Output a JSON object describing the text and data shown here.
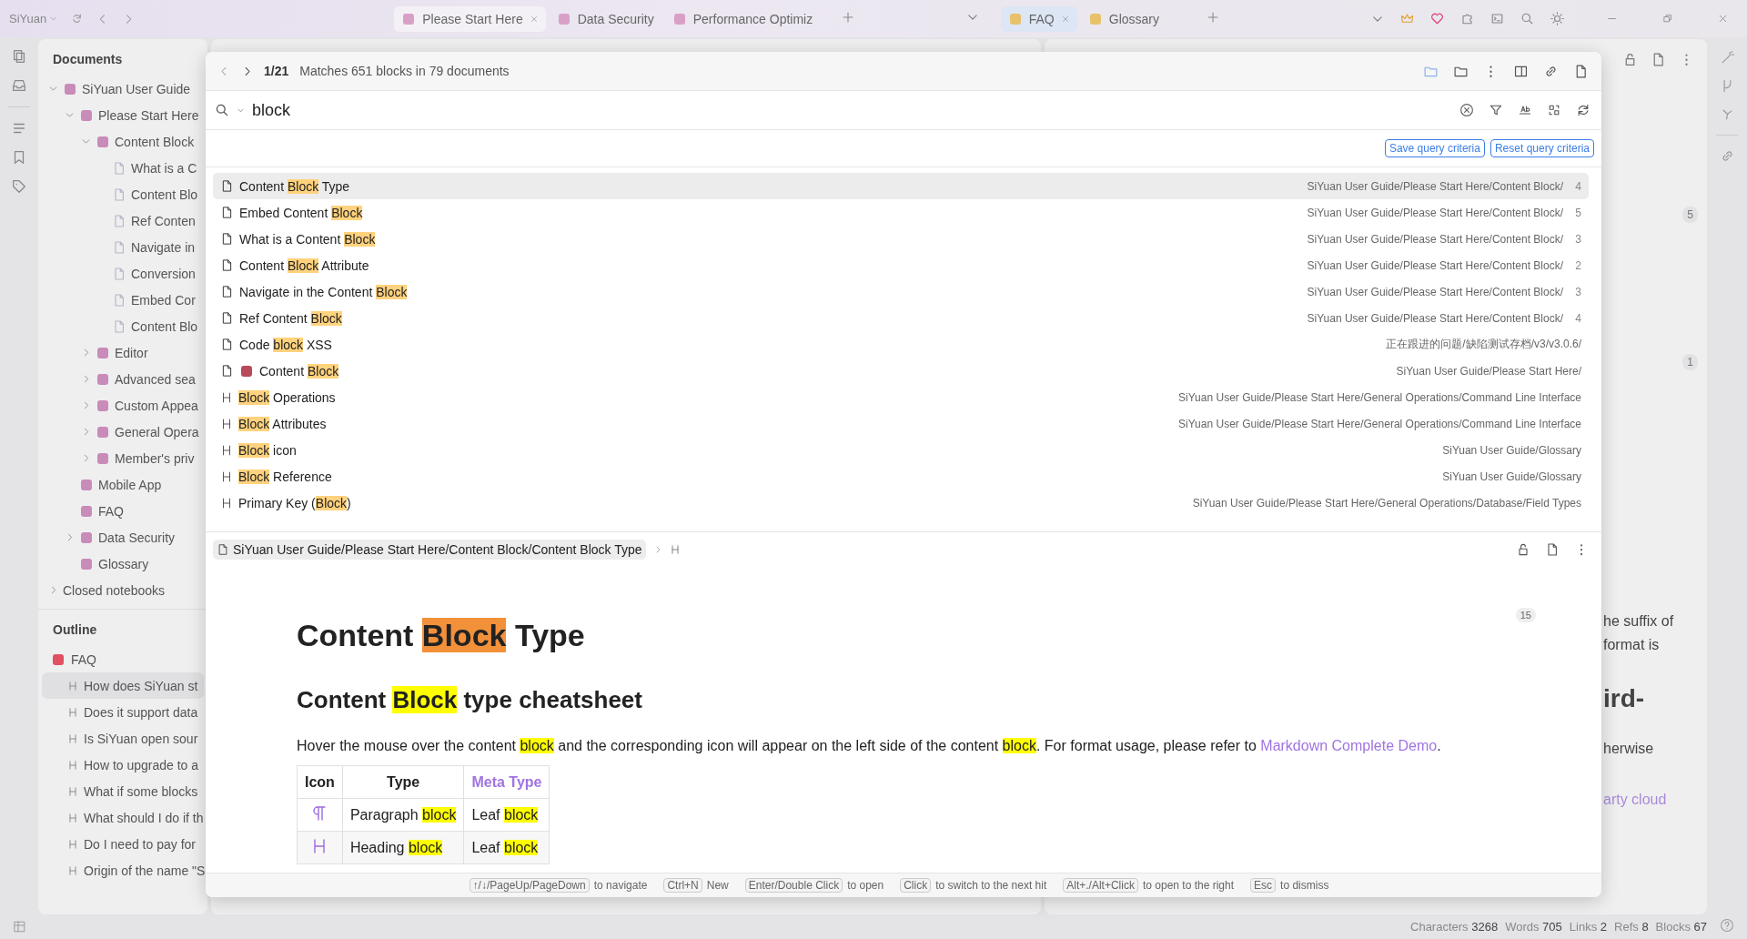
{
  "topbar": {
    "app_name": "SiYuan",
    "left_tabs": [
      {
        "label": "Please Start Here",
        "selected": true
      },
      {
        "label": "Data Security",
        "selected": false
      },
      {
        "label": "Performance Optimiz",
        "selected": false
      }
    ],
    "right_tabs": [
      {
        "label": "FAQ",
        "selected": true
      },
      {
        "label": "Glossary",
        "selected": false
      }
    ]
  },
  "sidebar": {
    "title": "Documents",
    "tree": [
      {
        "label": "SiYuan User Guide",
        "expanded": true,
        "children": [
          {
            "label": "Please Start Here",
            "expanded": true,
            "children": [
              {
                "label": "Content Block",
                "expanded": true,
                "children": [
                  {
                    "label": "What is a C"
                  },
                  {
                    "label": "Content Blo"
                  },
                  {
                    "label": "Ref Conten"
                  },
                  {
                    "label": "Navigate in"
                  },
                  {
                    "label": "Conversion"
                  },
                  {
                    "label": "Embed Cor"
                  },
                  {
                    "label": "Content Blo"
                  }
                ]
              },
              {
                "label": "Editor",
                "expanded": false
              },
              {
                "label": "Advanced sea",
                "expanded": false
              },
              {
                "label": "Custom Appea",
                "expanded": false
              },
              {
                "label": "General Opera",
                "expanded": false
              },
              {
                "label": "Member's priv",
                "expanded": false
              }
            ]
          },
          {
            "label": "Mobile App"
          },
          {
            "label": "FAQ"
          },
          {
            "label": "Data Security",
            "expanded": false
          },
          {
            "label": "Glossary"
          }
        ]
      }
    ],
    "closed_notebooks": {
      "label": "Closed notebooks",
      "expanded": false
    },
    "outline": {
      "title": "Outline",
      "root": "FAQ",
      "items": [
        {
          "label": "How does SiYuan st",
          "selected": true
        },
        {
          "label": "Does it support data",
          "selected": false
        },
        {
          "label": "Is SiYuan open sour",
          "selected": false
        },
        {
          "label": "How to upgrade to a",
          "selected": false
        },
        {
          "label": "What if some blocks",
          "selected": false
        },
        {
          "label": "What should I do if th",
          "selected": false
        },
        {
          "label": "Do I need to pay for",
          "selected": false
        },
        {
          "label": "Origin of the name \"S",
          "selected": false
        }
      ]
    }
  },
  "right_editor": {
    "badges": [
      "5",
      "1"
    ],
    "lines": [
      {
        "kind": "text",
        "text": "he suffix of"
      },
      {
        "kind": "text",
        "text": "format is"
      },
      {
        "kind": "heading",
        "text": "ird-"
      },
      {
        "kind": "text",
        "text": "herwise"
      },
      {
        "kind": "link",
        "text": "arty cloud"
      }
    ]
  },
  "search_dialog": {
    "position": "1/21",
    "summary": "Matches 651 blocks in 79 documents",
    "query": "block",
    "buttons": [
      "Save query criteria",
      "Reset query criteria"
    ],
    "results": [
      {
        "kind": "doc",
        "selected": true,
        "title": [
          {
            "text": "Content ",
            "match": false
          },
          {
            "text": "Block",
            "match": true
          },
          {
            "text": " Type",
            "match": false
          }
        ],
        "path": "SiYuan User Guide/Please Start Here/Content Block/",
        "count": "4"
      },
      {
        "kind": "doc",
        "selected": false,
        "title": [
          {
            "text": "Embed Content ",
            "match": false
          },
          {
            "text": "Block",
            "match": true
          }
        ],
        "path": "SiYuan User Guide/Please Start Here/Content Block/",
        "count": "5"
      },
      {
        "kind": "doc",
        "selected": false,
        "title": [
          {
            "text": "What is a Content ",
            "match": false
          },
          {
            "text": "Block",
            "match": true
          }
        ],
        "path": "SiYuan User Guide/Please Start Here/Content Block/",
        "count": "3"
      },
      {
        "kind": "doc",
        "selected": false,
        "title": [
          {
            "text": "Content ",
            "match": false
          },
          {
            "text": "Block",
            "match": true
          },
          {
            "text": " Attribute",
            "match": false
          }
        ],
        "path": "SiYuan User Guide/Please Start Here/Content Block/",
        "count": "2"
      },
      {
        "kind": "doc",
        "selected": false,
        "title": [
          {
            "text": "Navigate in the Content ",
            "match": false
          },
          {
            "text": "Block",
            "match": true
          }
        ],
        "path": "SiYuan User Guide/Please Start Here/Content Block/",
        "count": "3"
      },
      {
        "kind": "doc",
        "selected": false,
        "title": [
          {
            "text": "Ref Content ",
            "match": false
          },
          {
            "text": "Block",
            "match": true
          }
        ],
        "path": "SiYuan User Guide/Please Start Here/Content Block/",
        "count": "4"
      },
      {
        "kind": "doc",
        "selected": false,
        "title": [
          {
            "text": "Code ",
            "match": false
          },
          {
            "text": "block",
            "match": true
          },
          {
            "text": " XSS",
            "match": false
          }
        ],
        "path": "正在跟进的问题/缺陷测试存档/v3/v3.0.6/"
      },
      {
        "kind": "doc-emoji",
        "selected": false,
        "title": [
          {
            "text": "Content ",
            "match": false
          },
          {
            "text": "Block",
            "match": true
          }
        ],
        "path": "SiYuan User Guide/Please Start Here/"
      },
      {
        "kind": "heading",
        "selected": false,
        "title": [
          {
            "text": "Block",
            "match": true
          },
          {
            "text": " Operations",
            "match": false
          }
        ],
        "path": "SiYuan User Guide/Please Start Here/General Operations/Command Line Interface"
      },
      {
        "kind": "heading",
        "selected": false,
        "title": [
          {
            "text": "Block",
            "match": true
          },
          {
            "text": " Attributes",
            "match": false
          }
        ],
        "path": "SiYuan User Guide/Please Start Here/General Operations/Command Line Interface"
      },
      {
        "kind": "heading",
        "selected": false,
        "title": [
          {
            "text": "Block",
            "match": true
          },
          {
            "text": " icon",
            "match": false
          }
        ],
        "path": "SiYuan User Guide/Glossary"
      },
      {
        "kind": "heading",
        "selected": false,
        "title": [
          {
            "text": "Block",
            "match": true
          },
          {
            "text": " Reference",
            "match": false
          }
        ],
        "path": "SiYuan User Guide/Glossary"
      },
      {
        "kind": "heading",
        "selected": false,
        "title": [
          {
            "text": "Primary Key (",
            "match": false
          },
          {
            "text": "Block",
            "match": true
          },
          {
            "text": ")",
            "match": false
          }
        ],
        "path": "SiYuan User Guide/Please Start Here/General Operations/Database/Field Types"
      }
    ],
    "preview": {
      "breadcrumb": "SiYuan User Guide/Please Start Here/Content Block/Content Block Type",
      "badge": "15",
      "title": [
        {
          "kind": "text",
          "text": "Content "
        },
        {
          "kind": "current",
          "text": "Block"
        },
        {
          "kind": "text",
          "text": " Type"
        }
      ],
      "subtitle": [
        {
          "kind": "text",
          "text": "Content "
        },
        {
          "kind": "match",
          "text": "Block"
        },
        {
          "kind": "text",
          "text": " type cheatsheet"
        }
      ],
      "paragraph": [
        {
          "kind": "text",
          "text": "Hover the mouse over the content "
        },
        {
          "kind": "match",
          "text": "block"
        },
        {
          "kind": "text",
          "text": " and the corresponding icon will appear on the left side of the content "
        },
        {
          "kind": "match",
          "text": "block"
        },
        {
          "kind": "text",
          "text": ". For format usage, please refer to "
        },
        {
          "kind": "link",
          "text": "Markdown Complete Demo"
        },
        {
          "kind": "text",
          "text": "."
        }
      ],
      "table": {
        "columns": [
          {
            "label": "Icon",
            "kind": "text"
          },
          {
            "label": "Type",
            "kind": "text"
          },
          {
            "label": "Meta Type",
            "kind": "link"
          }
        ],
        "rows": [
          {
            "kind": "paragraph",
            "cells": [
              "",
              [
                {
                  "kind": "text",
                  "text": "Paragraph "
                },
                {
                  "kind": "match",
                  "text": "block"
                }
              ],
              [
                {
                  "kind": "text",
                  "text": "Leaf "
                },
                {
                  "kind": "match",
                  "text": "block"
                }
              ]
            ]
          },
          {
            "kind": "heading",
            "cells": [
              "",
              [
                {
                  "kind": "text",
                  "text": "Heading "
                },
                {
                  "kind": "match",
                  "text": "block"
                }
              ],
              [
                {
                  "kind": "text",
                  "text": "Leaf "
                },
                {
                  "kind": "match",
                  "text": "block"
                }
              ]
            ]
          }
        ]
      }
    },
    "hints": [
      {
        "key": "↑/↓/PageUp/PageDown",
        "action": "to navigate"
      },
      {
        "key": "Ctrl+N",
        "action": "New"
      },
      {
        "key": "Enter/Double Click",
        "action": "to open"
      },
      {
        "key": "Click",
        "action": "to switch to the next hit"
      },
      {
        "key": "Alt+./Alt+Click",
        "action": "to open to the right"
      },
      {
        "key": "Esc",
        "action": "to dismiss"
      }
    ]
  },
  "status_bar": [
    {
      "label": "Characters",
      "value": "3268"
    },
    {
      "label": "Words",
      "value": "705"
    },
    {
      "label": "Links",
      "value": "2"
    },
    {
      "label": "Refs",
      "value": "8"
    },
    {
      "label": "Blocks",
      "value": "67"
    }
  ]
}
